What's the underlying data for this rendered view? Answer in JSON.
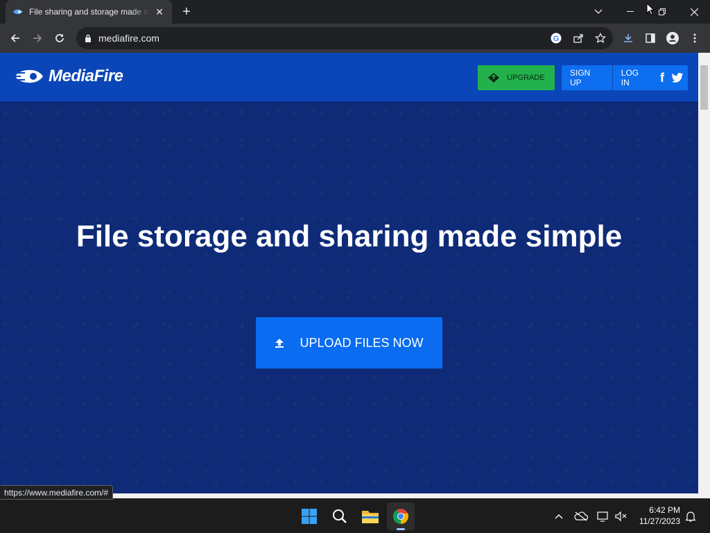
{
  "browser": {
    "tab_title": "File sharing and storage made simple",
    "tab_close": "✕",
    "new_tab": "+",
    "url": "mediafire.com",
    "status_url": "https://www.mediafire.com/#"
  },
  "site": {
    "brand": "MediaFire",
    "upgrade_label": "UPGRADE",
    "signup_label": "SIGN UP",
    "login_label": "LOG IN",
    "facebook_label": "f",
    "hero_heading": "File storage and sharing made simple",
    "upload_label": "UPLOAD FILES NOW"
  },
  "taskbar": {
    "time": "6:42 PM",
    "date": "11/27/2023"
  },
  "colors": {
    "header": "#0a46b8",
    "hero_bg": "#0f2b78",
    "upgrade": "#22b14c",
    "primary": "#0d6ef0"
  }
}
